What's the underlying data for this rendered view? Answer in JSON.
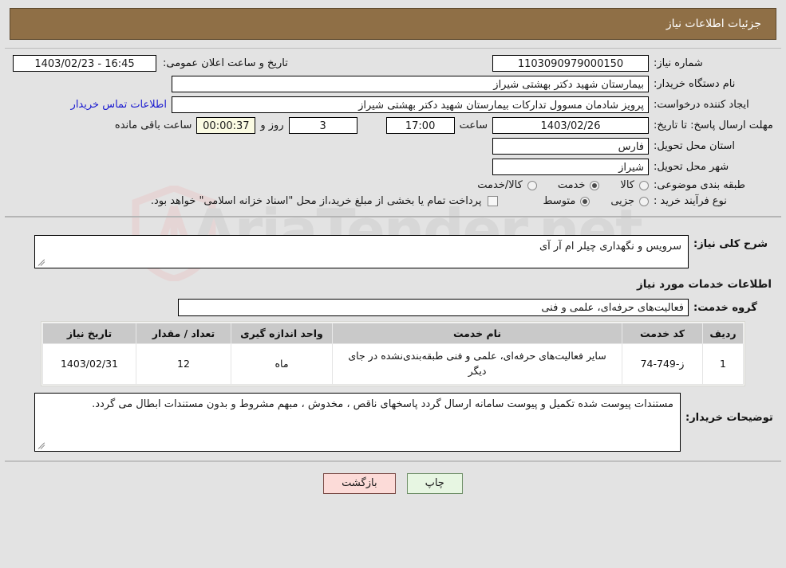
{
  "header": {
    "title": "جزئیات اطلاعات نیاز"
  },
  "need_info": {
    "need_number_label": "شماره نیاز:",
    "need_number_value": "1103090979000150",
    "announce_datetime_label": "تاریخ و ساعت اعلان عمومی:",
    "announce_datetime_value": "16:45 - 1403/02/23",
    "buyer_org_label": "نام دستگاه خریدار:",
    "buyer_org_value": "بیمارستان شهید دکتر بهشتی شیراز",
    "creator_label": "ایجاد کننده درخواست:",
    "creator_value": "پرویز شادمان مسوول تدارکات بیمارستان شهید دکتر بهشتی شیراز",
    "contact_link": "اطلاعات تماس خریدار",
    "deadline_label": "مهلت ارسال پاسخ: تا تاریخ:",
    "deadline_date": "1403/02/26",
    "deadline_time_label": "ساعت",
    "deadline_time": "17:00",
    "days_remaining": "3",
    "days_unit_label": "روز و",
    "countdown": "00:00:37",
    "countdown_suffix_label": "ساعت باقی مانده",
    "province_label": "استان محل تحویل:",
    "province_value": "فارس",
    "city_label": "شهر محل تحویل:",
    "city_value": "شیراز",
    "category_label": "طبقه بندی موضوعی:",
    "category_options": [
      {
        "label": "کالا",
        "selected": false
      },
      {
        "label": "خدمت",
        "selected": true
      },
      {
        "label": "کالا/خدمت",
        "selected": false
      }
    ],
    "purchase_type_label": "نوع فرآیند خرید :",
    "purchase_type_options": [
      {
        "label": "جزیی",
        "selected": false
      },
      {
        "label": "متوسط",
        "selected": true
      }
    ],
    "treasury_checkbox_label": "پرداخت تمام یا بخشی از مبلغ خرید،از محل \"اسناد خزانه اسلامی\" خواهد بود.",
    "treasury_checked": false
  },
  "description": {
    "general_label": "شرح کلی نیاز:",
    "general_value": "سرویس و نگهداری چیلر ام آر آی",
    "services_section_title": "اطلاعات خدمات مورد نیاز",
    "service_group_label": "گروه خدمت:",
    "service_group_value": "فعالیت‌های حرفه‌ای، علمی و فنی"
  },
  "items_table": {
    "columns": [
      "ردیف",
      "کد خدمت",
      "نام خدمت",
      "واحد اندازه گیری",
      "تعداد / مقدار",
      "تاریخ نیاز"
    ],
    "rows": [
      {
        "row_no": "1",
        "service_code": "ز-749-74",
        "service_name": "سایر فعالیت‌های حرفه‌ای، علمی و فنی طبقه‌بندی‌نشده در جای دیگر",
        "unit": "ماه",
        "quantity": "12",
        "need_date": "1403/02/31"
      }
    ]
  },
  "buyer_notes": {
    "label": "توضیحات خریدار:",
    "value": "مستندات پیوست شده تکمیل و پیوست سامانه ارسال گردد پاسخهای ناقص ، مخدوش ، مبهم مشروط و بدون مستندات ابطال می گردد."
  },
  "footer": {
    "back_button": "بازگشت",
    "print_button": "چاپ"
  },
  "watermark": {
    "text": "AriaTender.net"
  },
  "colors": {
    "header_bg": "#8f6f46",
    "page_bg": "#e3e3e3",
    "link": "#1a1ad0",
    "countdown_bg": "#fbfbe3",
    "back_btn_bg": "#fcdbd8",
    "print_btn_bg": "#e7f6e2",
    "table_header_bg": "#c9c9c9"
  }
}
